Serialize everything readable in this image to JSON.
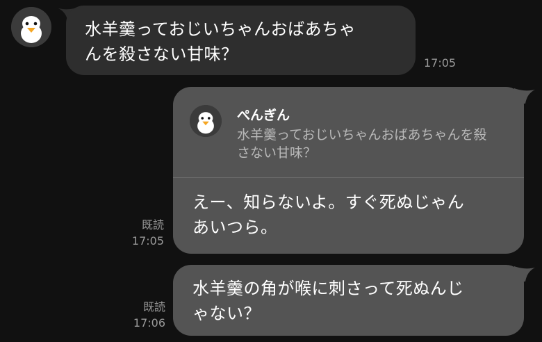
{
  "messages": [
    {
      "side": "incoming",
      "sender": "ぺんぎん",
      "text": "水羊羹っておじいちゃんおばあちゃ\nんを殺さない甘味？",
      "time": "17:05"
    },
    {
      "side": "outgoing",
      "reply_to": {
        "sender": "ぺんぎん",
        "text": "水羊羹っておじいちゃんおばあちゃんを殺\nさない甘味？"
      },
      "text": "えー、知らないよ。すぐ死ぬじゃん\nあいつら。",
      "read_label": "既読",
      "time": "17:05"
    },
    {
      "side": "outgoing",
      "text": "水羊羹の角が喉に刺さって死ぬんじ\nゃない？",
      "read_label": "既読",
      "time": "17:06"
    }
  ],
  "icons": {
    "avatar": "penguin-avatar-icon"
  },
  "colors": {
    "background": "#111111",
    "incoming_bubble": "#2e2e2e",
    "outgoing_bubble": "#545454",
    "meta_text": "#9a9a9a"
  }
}
